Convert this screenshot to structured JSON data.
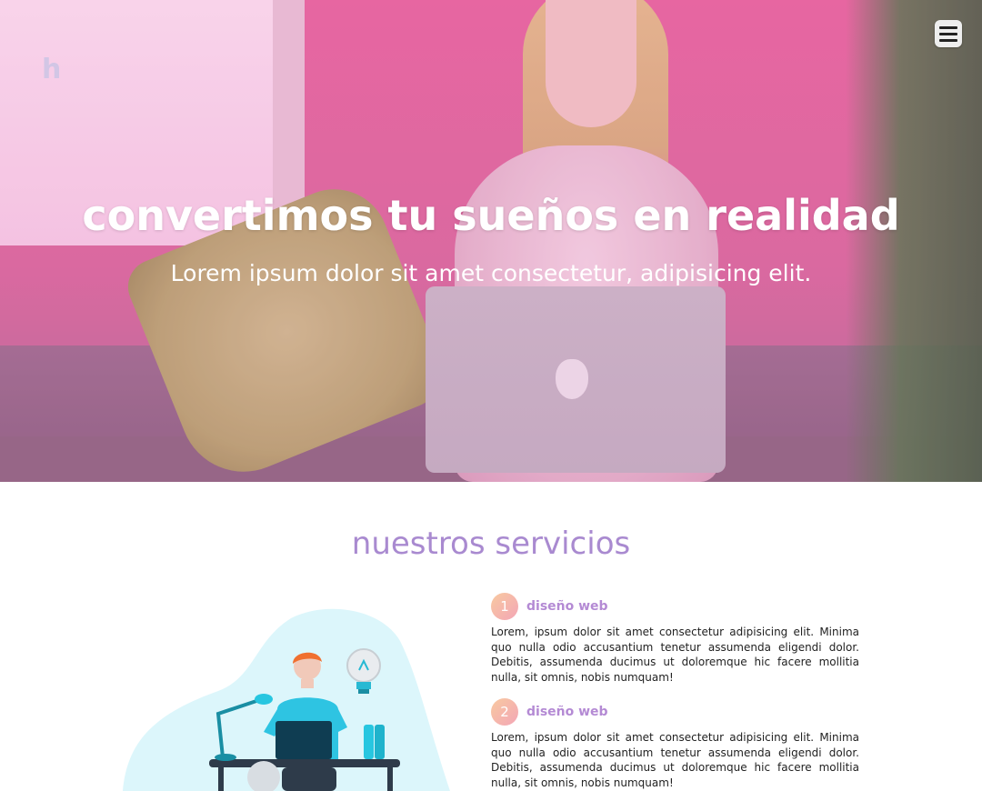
{
  "hero": {
    "title": "convertimos tu sueños en realidad",
    "subtitle": "Lorem ipsum dolor sit amet consectetur, adipisicing elit.",
    "logo_text": "h"
  },
  "menu": {
    "icon": "hamburger-menu-icon"
  },
  "services": {
    "title": "nuestros servicios",
    "items": [
      {
        "number": "1",
        "name": "diseño web",
        "text": "Lorem, ipsum dolor sit amet consectetur adipisicing elit. Minima quo nulla odio accusantium tenetur assumenda eligendi dolor. Debitis, assumenda ducimus ut doloremque hic facere mollitia nulla, sit omnis, nobis numquam!"
      },
      {
        "number": "2",
        "name": "diseño web",
        "text": "Lorem, ipsum dolor sit amet consectetur adipisicing elit. Minima quo nulla odio accusantium tenetur assumenda eligendi dolor. Debitis, assumenda ducimus ut doloremque hic facere mollitia nulla, sit omnis, nobis numquam!"
      }
    ]
  },
  "colors": {
    "accent_purple": "#a98ad0",
    "service_name": "#b48ad4",
    "badge_gradient_start": "#f8c9a0",
    "badge_gradient_end": "#f3a6b6",
    "hero_pink": "#e8669e"
  }
}
